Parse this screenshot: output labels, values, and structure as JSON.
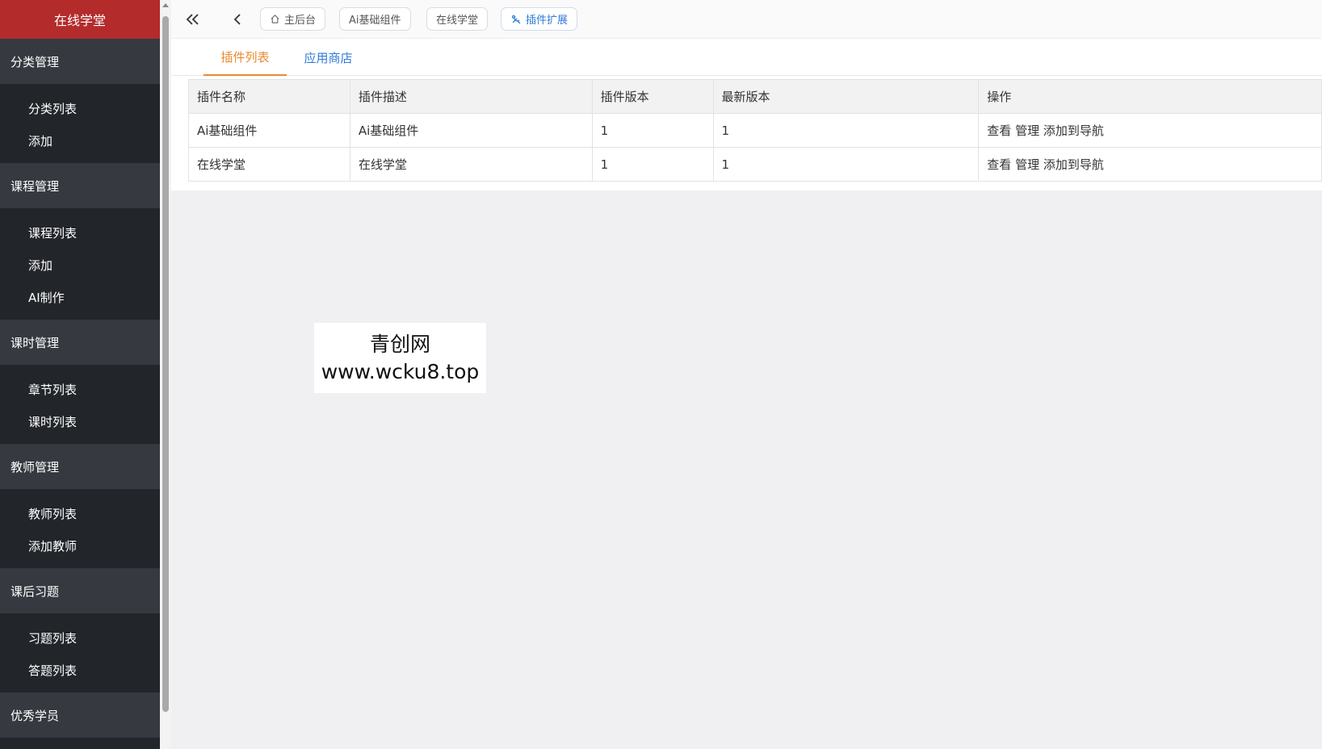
{
  "sidebar": {
    "brand": "在线学堂",
    "groups": [
      {
        "title": "分类管理",
        "items": [
          "分类列表",
          "添加"
        ]
      },
      {
        "title": "课程管理",
        "items": [
          "课程列表",
          "添加",
          "AI制作"
        ]
      },
      {
        "title": "课时管理",
        "items": [
          "章节列表",
          "课时列表"
        ]
      },
      {
        "title": "教师管理",
        "items": [
          "教师列表",
          "添加教师"
        ]
      },
      {
        "title": "课后习题",
        "items": [
          "习题列表",
          "答题列表"
        ]
      },
      {
        "title": "优秀学员",
        "items": []
      }
    ]
  },
  "topbar": {
    "icons": [
      "double-chevron-left-icon",
      "chevron-left-icon"
    ],
    "tags": [
      {
        "label": "主后台",
        "icon": "home-icon"
      },
      {
        "label": "Ai基础组件"
      },
      {
        "label": "在线学堂"
      },
      {
        "label": "插件扩展",
        "icon": "plugin-icon",
        "active": true
      }
    ]
  },
  "tabs": [
    {
      "label": "插件列表",
      "active": true
    },
    {
      "label": "应用商店",
      "active": false
    }
  ],
  "table": {
    "headers": [
      "插件名称",
      "插件描述",
      "插件版本",
      "最新版本",
      "操作"
    ],
    "rows": [
      {
        "name": "Ai基础组件",
        "desc": "Ai基础组件",
        "version": "1",
        "latest": "1",
        "actions": [
          "查看",
          "管理",
          "添加到导航"
        ]
      },
      {
        "name": "在线学堂",
        "desc": "在线学堂",
        "version": "1",
        "latest": "1",
        "actions": [
          "查看",
          "管理",
          "添加到导航"
        ]
      }
    ]
  },
  "watermark": {
    "line1": "青创网",
    "line2": "www.wcku8.top"
  },
  "colors": {
    "brand": "#b32b2b",
    "sidebar": "#22252a",
    "group": "#363a40",
    "accent": "#e98a32",
    "link": "#2f7bd9"
  }
}
